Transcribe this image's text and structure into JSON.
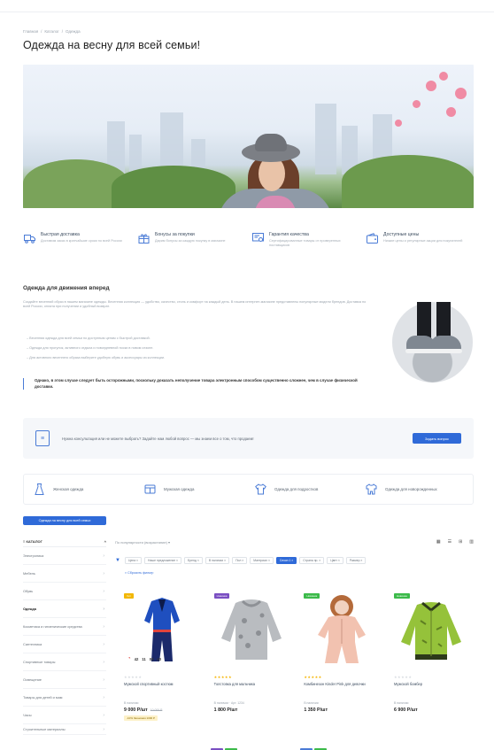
{
  "breadcrumb": [
    "Главная",
    "/",
    "Каталог",
    "/",
    "Одежда"
  ],
  "page_title": "Одежда на весну для всей семьи!",
  "features": [
    {
      "icon": "truck-icon",
      "title": "Быстрая доставка",
      "desc": "Доставим заказ в кратчайшие сроки по всей России"
    },
    {
      "icon": "gift-icon",
      "title": "Бонусы за покупки",
      "desc": "Дарим бонусы за каждую покупку в магазине"
    },
    {
      "icon": "certificate-icon",
      "title": "Гарантия качества",
      "desc": "Сертифицированные товары от проверенных поставщиков"
    },
    {
      "icon": "wallet-icon",
      "title": "Доступные цены",
      "desc": "Низкие цены и регулярные акции для покупателей"
    }
  ],
  "section": {
    "heading": "Одежда для движения вперед",
    "paragraph": "Создайте весенний образ в нашем магазине одежды. Весенняя коллекция — удобство, качество, стиль и комфорт на каждый день. В нашем интернет-магазине представлены популярные модели брендов. Доставка по всей России, оплата при получении и удобный возврат.",
    "bullets": [
      "Весенняя одежда для всей семьи по доступным ценам с быстрой доставкой.",
      "Одежда для прогулок, активного отдыха и повседневной носки в новом сезоне.",
      "Для активного весеннего образа выберите удобную обувь и аксессуары из коллекции."
    ],
    "quote": "Однако, в этом случае следует быть осторожными, поскольку доказать неполучение товара электронным способом существенно сложнее, чем в случае физической доставки."
  },
  "consult": {
    "text": "Нужна консультация или не можете выбрать? Задайте нам любой вопрос — мы знаем все о том, что продаем!",
    "button": "Задать вопрос"
  },
  "categories": [
    {
      "icon": "dress-icon",
      "label": "Женская одежда"
    },
    {
      "icon": "shirt-icon",
      "label": "Мужская одежда"
    },
    {
      "icon": "tshirt-icon",
      "label": "Одежда для подростков"
    },
    {
      "icon": "baby-clothes-icon",
      "label": "Одежда для новорожденных"
    }
  ],
  "tag_button": "Одежда на весну для всей семьи",
  "sidebar": {
    "header": "КАТАЛОГ",
    "items": [
      {
        "label": "Электроника",
        "active": false
      },
      {
        "label": "Мебель",
        "active": false
      },
      {
        "label": "Обувь",
        "active": false
      },
      {
        "label": "Одежда",
        "active": true
      },
      {
        "label": "Косметика и гигиенические средства",
        "active": false
      },
      {
        "label": "Сантехника",
        "active": false
      },
      {
        "label": "Спортивные товары",
        "active": false
      },
      {
        "label": "Освещение",
        "active": false
      },
      {
        "label": "Товары для детей и мам",
        "active": false
      },
      {
        "label": "Часы",
        "active": false
      },
      {
        "label": "Строительные материалы",
        "active": false
      }
    ]
  },
  "sortbar": {
    "label": "По популярности (возрастание) ▾"
  },
  "filters": [
    {
      "label": "Цена ×",
      "on": false
    },
    {
      "label": "Наше предложение ×",
      "on": false
    },
    {
      "label": "Бренд ×",
      "on": false
    },
    {
      "label": "В наличии ×",
      "on": false
    },
    {
      "label": "Пол ×",
      "on": false
    },
    {
      "label": "Материал ×",
      "on": false
    },
    {
      "label": "Сезон 1 ×",
      "on": true
    },
    {
      "label": "Страна пр. ×",
      "on": false
    },
    {
      "label": "Цвет ×",
      "on": false
    },
    {
      "label": "Размер ×",
      "on": false
    }
  ],
  "reset_label": "Сбросить фильтр",
  "products": [
    {
      "badge": "Хит",
      "badge_color": "#f2b705",
      "name": "Мужской спортивный костюм",
      "stock": "В наличии",
      "price": "9 000 Р/шт",
      "old_price": "10 000 Р",
      "promo": "-10%  Экономия 1000 Р",
      "rating": 0,
      "timer": [
        "42",
        "11",
        "03",
        "40"
      ]
    },
    {
      "badge": "Новинка",
      "badge_color": "#7a4fc2",
      "name": "Толстовка для мальчика",
      "stock": "В наличии  · Арт. 1234",
      "price": "1 800 Р/шт",
      "old_price": "",
      "promo": "",
      "rating": 5,
      "timer": []
    },
    {
      "badge": "Новинка",
      "badge_color": "#3cba4a",
      "name": "Комбинезон Kinder Pink для девочки",
      "stock": "В наличии",
      "price": "1 350 Р/шт",
      "old_price": "",
      "promo": "",
      "rating": 5,
      "timer": []
    },
    {
      "badge": "Новинка",
      "badge_color": "#3cba4a",
      "name": "Мужской бомбер",
      "stock": "В наличии",
      "price": "6 900 Р/шт",
      "old_price": "",
      "promo": "",
      "rating": 0,
      "timer": []
    }
  ],
  "colors": {
    "accent": "#2f6ad8",
    "icon_blue": "#4a7bd6"
  }
}
